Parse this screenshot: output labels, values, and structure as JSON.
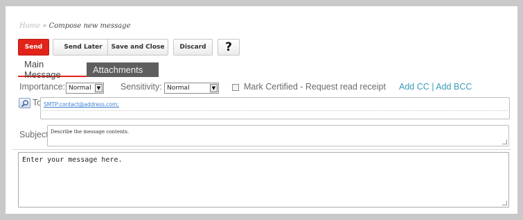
{
  "breadcrumb": {
    "home": "Home",
    "separator": " » ",
    "current": "Compose new message"
  },
  "toolbar": {
    "send": "Send",
    "send_later": "Send Later",
    "save_and_close": "Save and Close",
    "discard": "Discard",
    "help": "?"
  },
  "tabs": {
    "main": "Main Message",
    "attachments": "Attachments"
  },
  "options": {
    "importance_label": "Importance:",
    "importance_value": "Normal",
    "sensitivity_label": "Sensitivity:",
    "sensitivity_value": "Normal",
    "mark_certified": "Mark Certified - Request read receipt",
    "add_cc_bcc": "Add CC | Add BCC"
  },
  "to": {
    "label": "To",
    "value": "SMTP:contact@address.com;"
  },
  "subject": {
    "label": "Subject",
    "value": "Describe the message contents."
  },
  "body": {
    "value": "Enter your message here."
  },
  "colors": {
    "accent": "#e2231a",
    "link": "#3a9bb8",
    "tab_inactive": "#5e5e5e"
  },
  "icons": {
    "address_book": "magnifier-address-icon",
    "dropdown": "dropdown-arrow-icon"
  }
}
